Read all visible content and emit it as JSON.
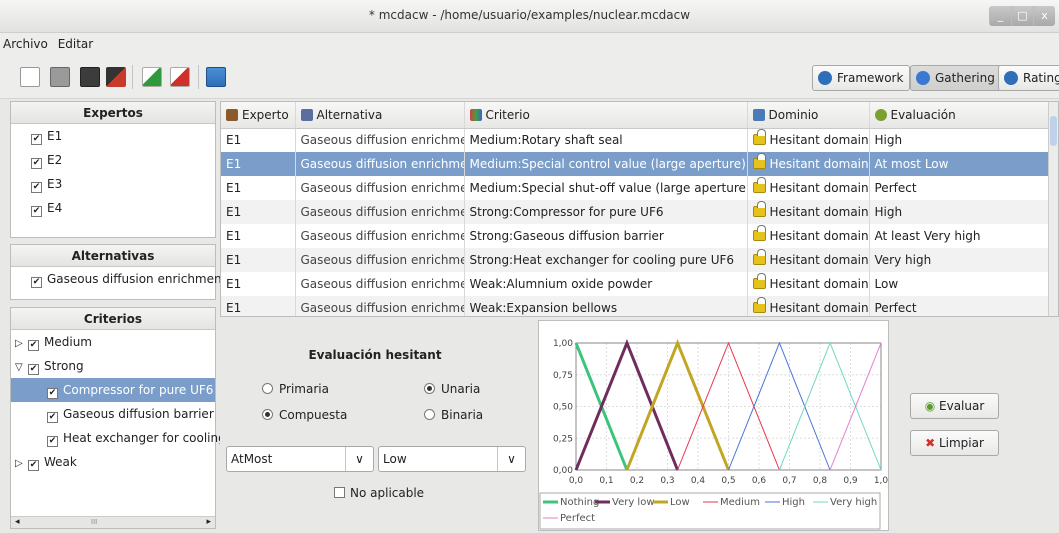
{
  "window": {
    "title": "* mcdacw - /home/usuario/examples/nuclear.mcdacw",
    "controls": [
      "_",
      "□",
      "x"
    ]
  },
  "menu": [
    "Archivo",
    "Editar"
  ],
  "modes": [
    {
      "label": "Framework",
      "icon": "framework-icon",
      "active": false
    },
    {
      "label": "Gathering",
      "icon": "check-icon",
      "active": true
    },
    {
      "label": "Rating",
      "icon": "rating-icon",
      "active": false
    }
  ],
  "experts": {
    "title": "Expertos",
    "items": [
      "E1",
      "E2",
      "E3",
      "E4"
    ]
  },
  "alternatives": {
    "title": "Alternativas",
    "items": [
      "Gaseous diffusion enrichment"
    ]
  },
  "criteria": {
    "title": "Criterios",
    "nodes": [
      {
        "label": "Medium",
        "level": 0,
        "expander": "▷",
        "selected": false
      },
      {
        "label": "Strong",
        "level": 0,
        "expander": "▽",
        "selected": false
      },
      {
        "label": "Compressor for pure UF6",
        "level": 1,
        "expander": "",
        "selected": true
      },
      {
        "label": "Gaseous diffusion barrier",
        "level": 1,
        "expander": "",
        "selected": false
      },
      {
        "label": "Heat exchanger for cooling",
        "level": 1,
        "expander": "",
        "selected": false
      },
      {
        "label": "Weak",
        "level": 0,
        "expander": "▷",
        "selected": false
      }
    ],
    "scroll_label": "III"
  },
  "table": {
    "headers": [
      "Experto",
      "Alternativa",
      "Criterio",
      "Dominio",
      "Evaluación"
    ],
    "rows": [
      [
        "E1",
        "Gaseous diffusion enrichment",
        "Medium:Rotary shaft seal",
        "Hesitant domain",
        "High"
      ],
      [
        "E1",
        "Gaseous diffusion enrichment",
        "Medium:Special control value (large aperture)",
        "Hesitant domain",
        "At most Low"
      ],
      [
        "E1",
        "Gaseous diffusion enrichment",
        "Medium:Special shut-off value (large aperture)",
        "Hesitant domain",
        "Perfect"
      ],
      [
        "E1",
        "Gaseous diffusion enrichment",
        "Strong:Compressor for pure UF6",
        "Hesitant domain",
        "High"
      ],
      [
        "E1",
        "Gaseous diffusion enrichment",
        "Strong:Gaseous diffusion barrier",
        "Hesitant domain",
        "At least Very high"
      ],
      [
        "E1",
        "Gaseous diffusion enrichment",
        "Strong:Heat exchanger for cooling pure UF6",
        "Hesitant domain",
        "Very high"
      ],
      [
        "E1",
        "Gaseous diffusion enrichment",
        "Weak:Alumnium oxide powder",
        "Hesitant domain",
        "Low"
      ],
      [
        "E1",
        "Gaseous diffusion enrichment",
        "Weak:Expansion bellows",
        "Hesitant domain",
        "Perfect"
      ]
    ],
    "selected_row": 1
  },
  "hesitant": {
    "title": "Evaluación hesitant",
    "radios": [
      {
        "label": "Primaria",
        "checked": false
      },
      {
        "label": "Unaria",
        "checked": true
      },
      {
        "label": "Compuesta",
        "checked": true
      },
      {
        "label": "Binaria",
        "checked": false
      }
    ],
    "combo1": "AtMost",
    "combo2": "Low",
    "not_applicable": "No aplicable"
  },
  "buttons": {
    "evaluate": "Evaluar",
    "clear": "Limpiar"
  },
  "chart_data": {
    "type": "line",
    "x_ticks": [
      "0,0",
      "0,1",
      "0,2",
      "0,3",
      "0,4",
      "0,5",
      "0,6",
      "0,7",
      "0,8",
      "0,9",
      "1,0"
    ],
    "y_ticks": [
      "0,00",
      "0,25",
      "0,50",
      "0,75",
      "1,00"
    ],
    "xlim": [
      0,
      1
    ],
    "ylim": [
      0,
      1
    ],
    "series": [
      {
        "name": "Nothing",
        "color": "#3cc47c",
        "bold": true,
        "points": [
          [
            0,
            1
          ],
          [
            0.167,
            0
          ]
        ]
      },
      {
        "name": "Very low",
        "color": "#6e2d5c",
        "bold": true,
        "points": [
          [
            0,
            0
          ],
          [
            0.167,
            1
          ],
          [
            0.333,
            0
          ]
        ]
      },
      {
        "name": "Low",
        "color": "#c2a623",
        "bold": true,
        "points": [
          [
            0.167,
            0
          ],
          [
            0.333,
            1
          ],
          [
            0.5,
            0
          ]
        ]
      },
      {
        "name": "Medium",
        "color": "#e8364f",
        "bold": false,
        "points": [
          [
            0.333,
            0
          ],
          [
            0.5,
            1
          ],
          [
            0.667,
            0
          ]
        ]
      },
      {
        "name": "High",
        "color": "#4a74d9",
        "bold": false,
        "points": [
          [
            0.5,
            0
          ],
          [
            0.667,
            1
          ],
          [
            0.833,
            0
          ]
        ]
      },
      {
        "name": "Very high",
        "color": "#6fd9c2",
        "bold": false,
        "points": [
          [
            0.667,
            0
          ],
          [
            0.833,
            1
          ],
          [
            1,
            0
          ]
        ]
      },
      {
        "name": "Perfect",
        "color": "#e27fd0",
        "bold": false,
        "points": [
          [
            0.833,
            0
          ],
          [
            1,
            1
          ]
        ]
      }
    ]
  }
}
